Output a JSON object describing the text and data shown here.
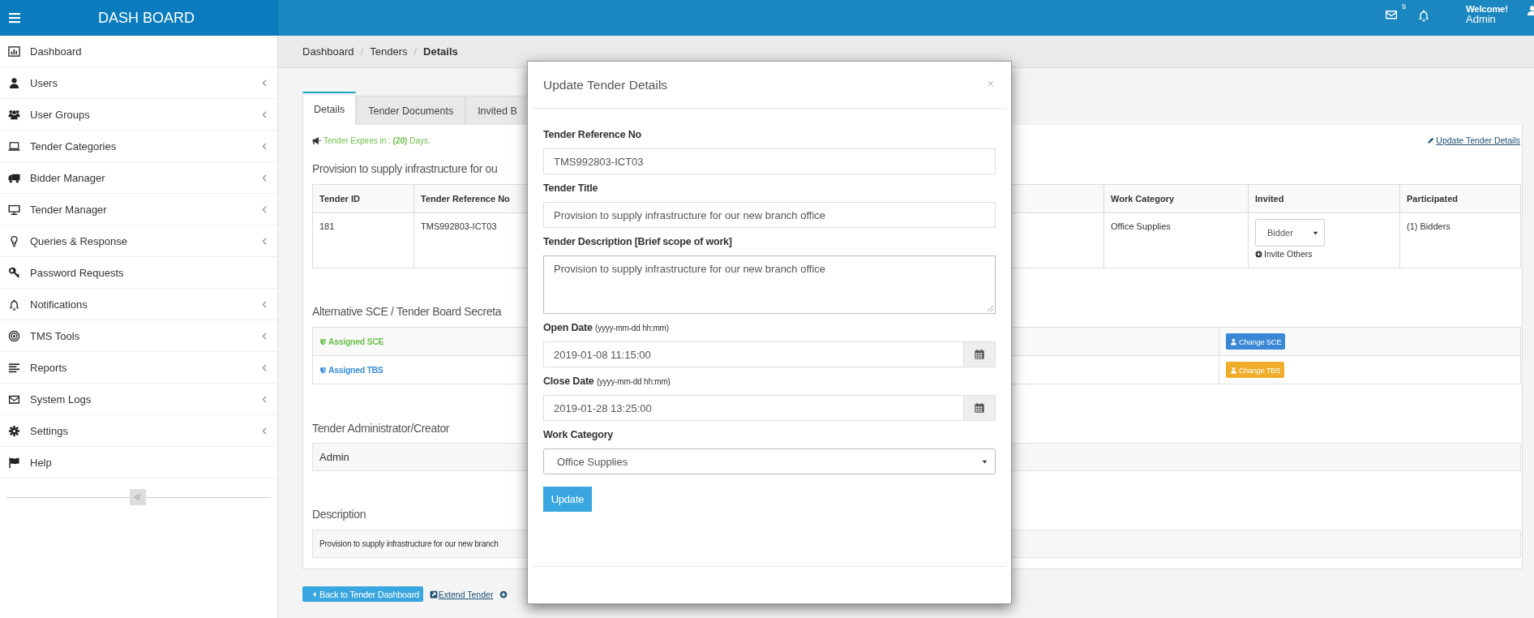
{
  "topbar": {
    "brand": "DASH BOARD",
    "mail_badge": "9",
    "welcome": "Welcome!",
    "user": "Admin"
  },
  "sidebar": {
    "items": [
      {
        "label": "Dashboard",
        "kind": "link"
      },
      {
        "label": "Users",
        "kind": "submenu"
      },
      {
        "label": "User Groups",
        "kind": "submenu"
      },
      {
        "label": "Tender Categories",
        "kind": "submenu"
      },
      {
        "label": "Bidder Manager",
        "kind": "submenu"
      },
      {
        "label": "Tender Manager",
        "kind": "submenu"
      },
      {
        "label": "Queries & Response",
        "kind": "submenu"
      },
      {
        "label": "Password Requests",
        "kind": "link"
      },
      {
        "label": "Notifications",
        "kind": "submenu"
      },
      {
        "label": "TMS Tools",
        "kind": "submenu"
      },
      {
        "label": "Reports",
        "kind": "submenu"
      },
      {
        "label": "System Logs",
        "kind": "submenu"
      },
      {
        "label": "Settings",
        "kind": "submenu"
      },
      {
        "label": "Help",
        "kind": "link"
      }
    ]
  },
  "breadcrumb": [
    {
      "label": "Dashboard",
      "current": false
    },
    {
      "separator": "/",
      "label": "Tenders",
      "current": false
    },
    {
      "separator": "/",
      "label": "Details",
      "current": true
    }
  ],
  "tabs": [
    {
      "label": "Details",
      "selected": true
    },
    {
      "label": "Tender Documents",
      "selected": false
    },
    {
      "label": "Invited B",
      "selected": false
    }
  ],
  "expiry_notice": "Tender Expires in : **(20)** Days.",
  "update_link": "Update Tender Details",
  "tender_heading": "Provision to supply infrastructure for ou",
  "tender_table": {
    "columns": [
      "Tender ID",
      "Tender Reference No",
      "Work Category",
      "Invited",
      "Participated"
    ],
    "row": {
      "tender_id": "181",
      "reference_no": "TMS992803-ICT03",
      "work_category": "Office Supplies",
      "invited_select": "Bidder",
      "invite_link": "Invite Others",
      "participated": "(1) Bidders"
    }
  },
  "secretariat": {
    "heading": "Alternative SCE / Tender Board Secreta",
    "rows": [
      {
        "label": "Assigned SCE",
        "color": "#6cc04a",
        "button": "Change SCE",
        "kind": "primary"
      },
      {
        "label": "Assigned TBS",
        "color": "#3c8dd8",
        "button": "Change TBS",
        "kind": "warning"
      }
    ]
  },
  "administrator": {
    "heading": "Tender Administrator/Creator",
    "value": "Admin"
  },
  "description": {
    "heading": "Description",
    "text": "Provision to supply infrastructure for our new branch"
  },
  "actions": {
    "back_button": "Back to Tender Dashboard",
    "extend_link": "Extend Tender"
  },
  "modal": {
    "title": "Update Tender Details",
    "fields": [
      {
        "kind": "text",
        "label": "Tender Reference No",
        "value": "TMS992803-ICT03"
      },
      {
        "kind": "text",
        "label": "Tender Title",
        "value": "Provision to supply infrastructure for our new branch office"
      },
      {
        "kind": "textarea",
        "label": "Tender Description [Brief scope of work]",
        "value": "Provision to supply infrastructure for our new branch office"
      },
      {
        "kind": "date",
        "label": "Open Date",
        "hint": "(yyyy-mm-dd hh:mm)",
        "value": "2019-01-08 11:15:00"
      },
      {
        "kind": "date",
        "label": "Close Date",
        "hint": "(yyyy-mm-dd hh:mm)",
        "value": "2019-01-28 13:25:00"
      },
      {
        "kind": "select",
        "label": "Work Category",
        "value": "Office Supplies"
      }
    ],
    "submit": "Update"
  }
}
